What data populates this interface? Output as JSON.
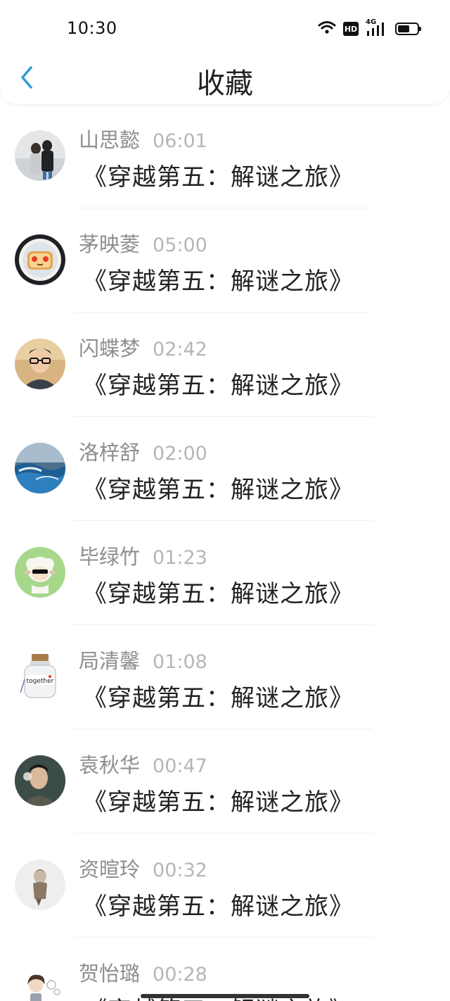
{
  "status": {
    "time": "10:30",
    "hd_label": "HD",
    "network_label": "4G",
    "icons": [
      "wifi-icon",
      "hd-icon",
      "signal-icon",
      "battery-icon"
    ],
    "battery_level": 0.6
  },
  "header": {
    "back_icon": "chevron-left-icon",
    "title": "收藏"
  },
  "colors": {
    "accent": "#2f9bd8",
    "title_text": "#222222",
    "name_text": "#8e8e8e",
    "time_text": "#b6b6b6"
  },
  "items": [
    {
      "name": "山思懿",
      "time": "06:01",
      "title": "《穿越第五：解谜之旅》",
      "avatar": "couple-photo"
    },
    {
      "name": "茅映菱",
      "time": "05:00",
      "title": "《穿越第五：解谜之旅》",
      "avatar": "toast-on-plate"
    },
    {
      "name": "闪蝶梦",
      "time": "02:42",
      "title": "《穿越第五：解谜之旅》",
      "avatar": "man-with-glasses"
    },
    {
      "name": "洛梓舒",
      "time": "02:00",
      "title": "《穿越第五：解谜之旅》",
      "avatar": "ocean-wave"
    },
    {
      "name": "毕绿竹",
      "time": "01:23",
      "title": "《穿越第五：解谜之旅》",
      "avatar": "cartoon-sheep"
    },
    {
      "name": "局清馨",
      "time": "01:08",
      "title": "《穿越第五：解谜之旅》",
      "avatar": "together-bottle"
    },
    {
      "name": "袁秋华",
      "time": "00:47",
      "title": "《穿越第五：解谜之旅》",
      "avatar": "man-portrait"
    },
    {
      "name": "资暄玲",
      "time": "00:32",
      "title": "《穿越第五：解谜之旅》",
      "avatar": "figurine"
    },
    {
      "name": "贺怡璐",
      "time": "00:28",
      "title": "《穿越第五：解谜之旅》",
      "avatar": "girl-sketch"
    }
  ]
}
